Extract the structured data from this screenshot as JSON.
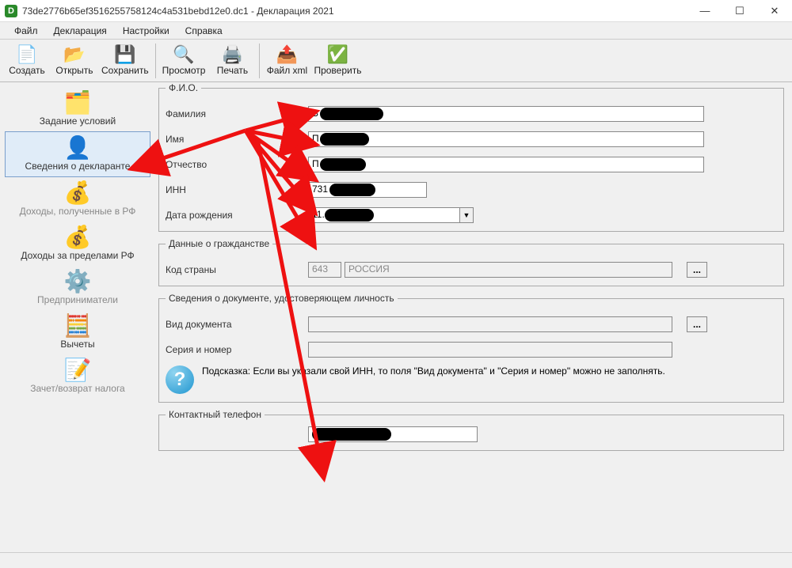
{
  "window": {
    "title": "73de2776b65ef3516255758124c4a531bebd12e0.dc1 - Декларация 2021"
  },
  "menu": {
    "file": "Файл",
    "decl": "Декларация",
    "settings": "Настройки",
    "help": "Справка"
  },
  "toolbar": {
    "create": "Создать",
    "open": "Открыть",
    "save": "Сохранить",
    "preview": "Просмотр",
    "print": "Печать",
    "xml": "Файл xml",
    "check": "Проверить"
  },
  "sidebar": {
    "cond": "Задание условий",
    "declarant": "Сведения о декларанте",
    "income_rf": "Доходы, полученные в РФ",
    "income_abroad": "Доходы за пределами РФ",
    "entrepreneur": "Предприниматели",
    "deductions": "Вычеты",
    "offset": "Зачет/возврат налога"
  },
  "groups": {
    "fio": "Ф.И.О.",
    "citizen": "Данные о гражданстве",
    "doc": "Сведения о документе, удостоверяющем личность",
    "phone": "Контактный телефон"
  },
  "labels": {
    "lastname": "Фамилия",
    "firstname": "Имя",
    "patronymic": "Отчество",
    "inn": "ИНН",
    "dob": "Дата рождения",
    "country_code": "Код страны",
    "doc_type": "Вид документа",
    "doc_serial": "Серия и номер",
    "hint_prefix": "Подсказка:",
    "hint_text": "Если вы указали свой ИНН, то поля \"Вид документа\" и \"Серия и номер\" можно не заполнять."
  },
  "values": {
    "lastname": "В",
    "firstname": "П",
    "patronymic": "П",
    "inn": "731",
    "dob": "11.",
    "country_code": "643",
    "country_name": "РОССИЯ",
    "doc_type": "",
    "doc_serial": "",
    "phone": ""
  }
}
